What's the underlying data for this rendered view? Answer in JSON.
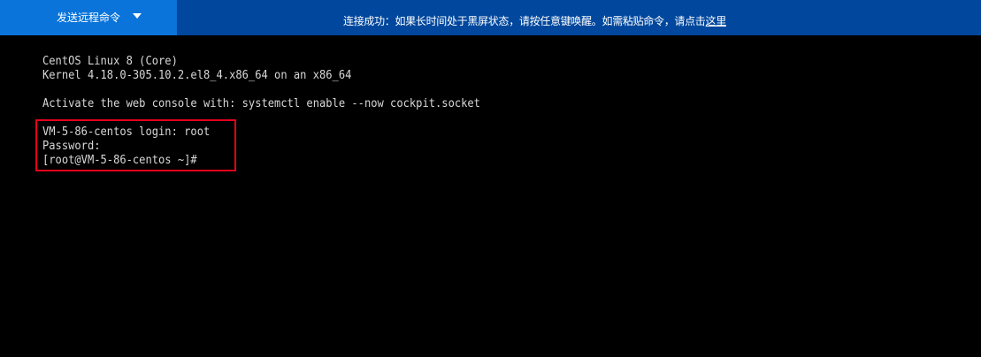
{
  "toolbar": {
    "send_command_label": "发送远程命令",
    "status_message": "连接成功：如果长时间处于黑屏状态，请按任意键唤醒。如需粘贴命令，请点击",
    "status_link_text": "这里",
    "colors": {
      "bar": "#00479d",
      "button": "#0a74da",
      "highlight": "#e5001a"
    },
    "icons": {
      "dropdown": "chevron-down-icon"
    }
  },
  "terminal": {
    "os_line": "CentOS Linux 8 (Core)",
    "kernel_line": "Kernel 4.18.0-305.10.2.el8_4.x86_64 on an x86_64",
    "cockpit_line": "Activate the web console with: systemctl enable --now cockpit.socket",
    "login_line": "VM-5-86-centos login: root",
    "password_line": "Password:",
    "prompt_line": "[root@VM-5-86-centos ~]#"
  }
}
